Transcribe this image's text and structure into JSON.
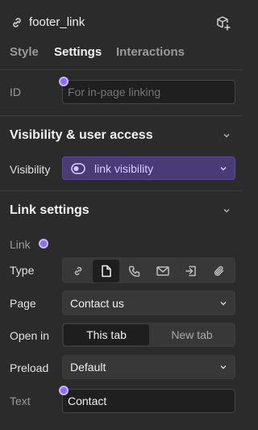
{
  "header": {
    "title": "footer_link"
  },
  "tabs": [
    {
      "label": "Style"
    },
    {
      "label": "Settings"
    },
    {
      "label": "Interactions"
    }
  ],
  "id_field": {
    "label": "ID",
    "placeholder": "For in-page linking",
    "value": ""
  },
  "visibility_section": {
    "title": "Visibility & user access",
    "label": "Visibility",
    "value": "link visibility"
  },
  "link_section": {
    "title": "Link settings",
    "link_label": "Link",
    "type_label": "Type",
    "type_options": [
      "url-icon",
      "page-icon",
      "phone-icon",
      "email-icon",
      "section-icon",
      "attachment-icon"
    ],
    "type_selected": "page-icon",
    "page_label": "Page",
    "page_value": "Contact us",
    "open_in_label": "Open in",
    "open_in_options": [
      "This tab",
      "New tab"
    ],
    "open_in_selected": "This tab",
    "preload_label": "Preload",
    "preload_value": "Default",
    "text_label": "Text",
    "text_value": "Contact"
  },
  "colors": {
    "background": "#2b2b2b",
    "accent": "#8b6cf2",
    "visibility_bg": "#4a3a78"
  }
}
